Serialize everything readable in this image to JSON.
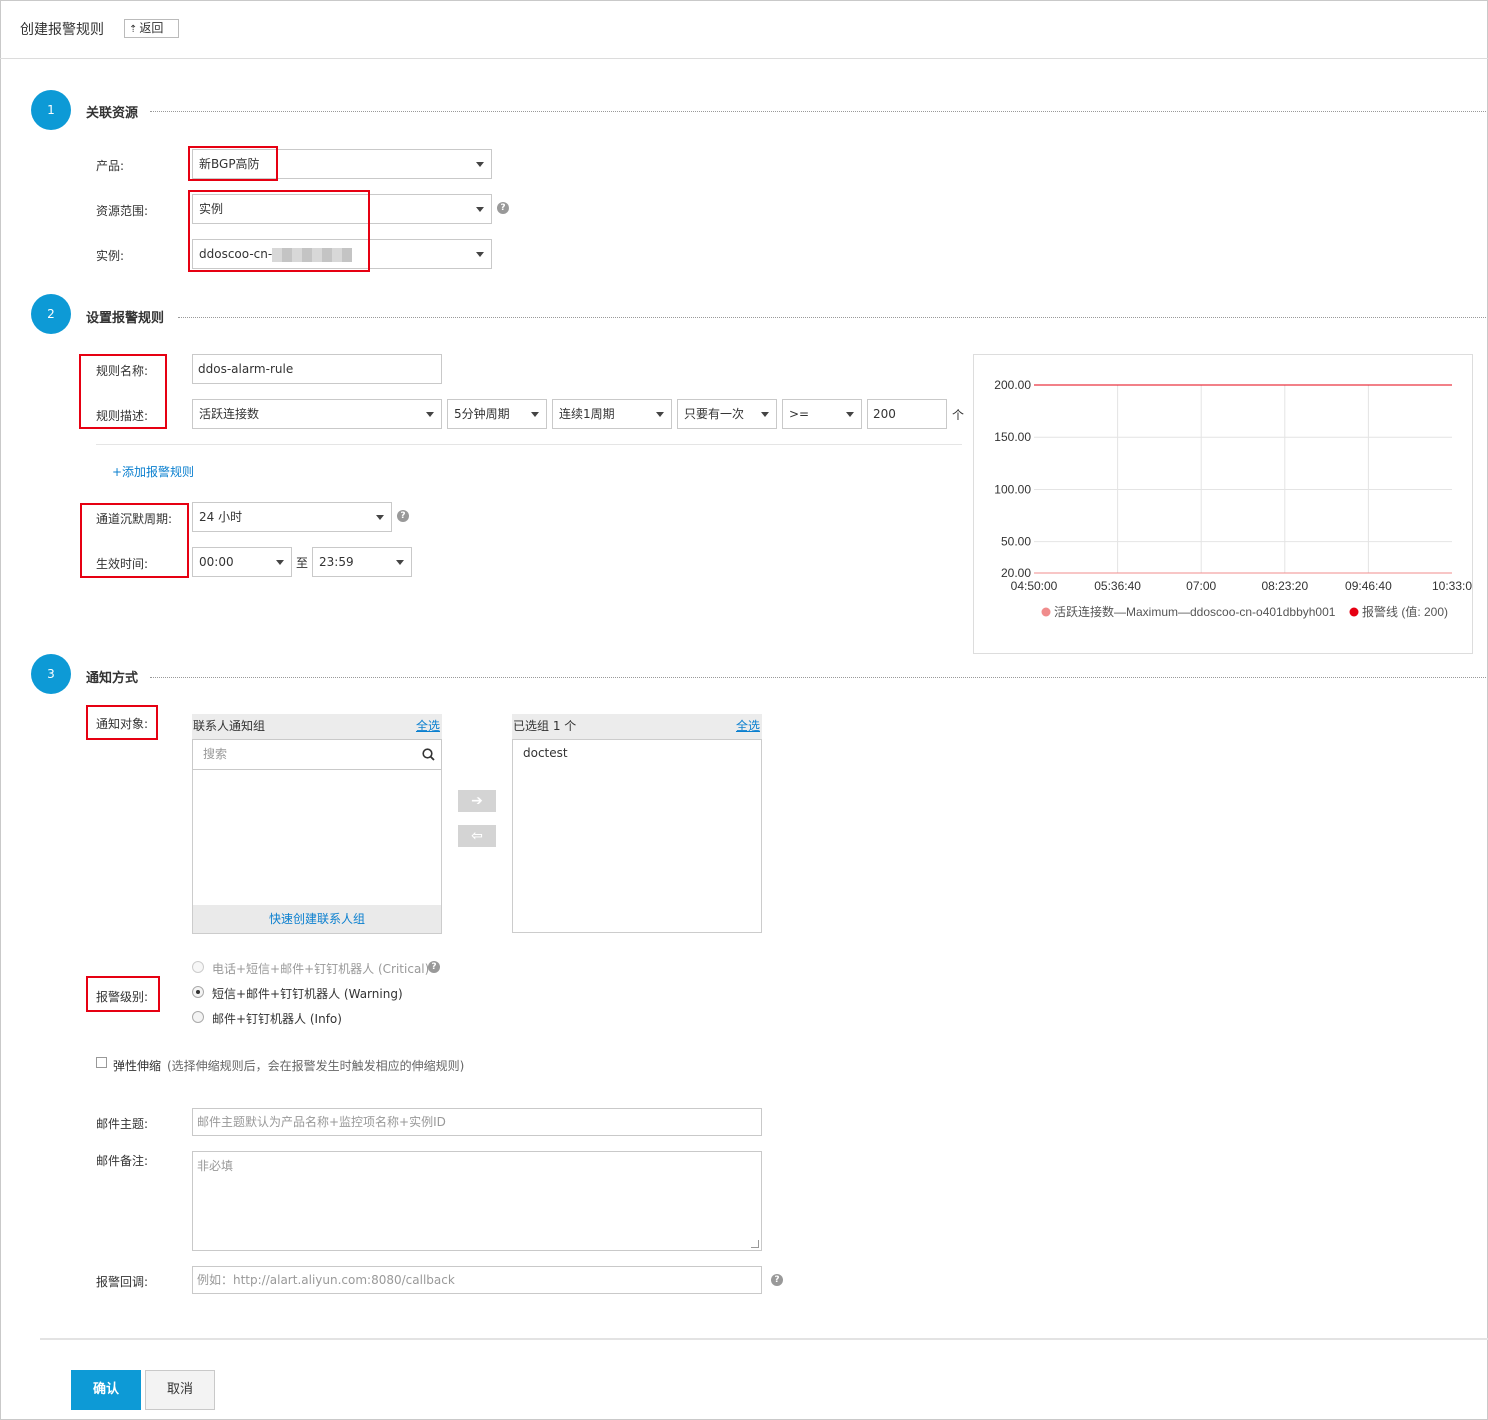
{
  "header": {
    "title": "创建报警规则",
    "back_label": "返回"
  },
  "step1": {
    "number": "1",
    "title": "关联资源",
    "product_label": "产品:",
    "product_value": "新BGP高防",
    "scope_label": "资源范围:",
    "scope_value": "实例",
    "instance_label": "实例:",
    "instance_value": "ddoscoo-cn-"
  },
  "step2": {
    "number": "2",
    "title": "设置报警规则",
    "rule_name_label": "规则名称:",
    "rule_name_value": "ddos-alarm-rule",
    "rule_desc_label": "规则描述:",
    "metric_value": "活跃连接数",
    "period_value": "5分钟周期",
    "consecutive_value": "连续1周期",
    "frequency_value": "只要有一次",
    "operator_value": ">=",
    "threshold_value": "200",
    "unit": "个",
    "add_rule_label": "+添加报警规则",
    "silence_label": "通道沉默周期:",
    "silence_value": "24 小时",
    "effective_label": "生效时间:",
    "start_time": "00:00",
    "to_label": "至",
    "end_time": "23:59"
  },
  "chart_data": {
    "type": "line",
    "y_ticks": [
      "200.00",
      "150.00",
      "100.00",
      "50.00",
      "20.00"
    ],
    "x_ticks": [
      "04:50:00",
      "05:36:40",
      "07:00",
      "08:23:20",
      "09:46:40",
      "10:33:0"
    ],
    "ylim": [
      20,
      200
    ],
    "grid": true,
    "legend_placement": "bottom",
    "series": [
      {
        "name": "活跃连接数—Maximum—ddoscoo-cn-o401dbbyh001",
        "color": "#f08c8c",
        "values": [
          20,
          20,
          20,
          20,
          20,
          20
        ]
      },
      {
        "name": "报警线 (值: 200)",
        "color": "#e60012",
        "values": [
          200,
          200,
          200,
          200,
          200,
          200
        ]
      }
    ]
  },
  "step3": {
    "number": "3",
    "title": "通知方式",
    "target_label": "通知对象:",
    "left_panel_title": "联系人通知组",
    "select_all": "全选",
    "search_placeholder": "搜索",
    "quick_create": "快速创建联系人组",
    "right_panel_title": "已选组 1 个",
    "selected_items": [
      "doctest"
    ],
    "level_label": "报警级别:",
    "level_critical": "电话+短信+邮件+钉钉机器人 (Critical)",
    "level_warning": "短信+邮件+钉钉机器人 (Warning)",
    "level_info": "邮件+钉钉机器人 (Info)",
    "autoscale_label": "弹性伸缩",
    "autoscale_hint": "(选择伸缩规则后，会在报警发生时触发相应的伸缩规则)",
    "email_subject_label": "邮件主题:",
    "email_subject_placeholder": "邮件主题默认为产品名称+监控项名称+实例ID",
    "email_note_label": "邮件备注:",
    "email_note_placeholder": "非必填",
    "callback_label": "报警回调:",
    "callback_placeholder": "例如：http://alart.aliyun.com:8080/callback"
  },
  "footer": {
    "confirm_label": "确认",
    "cancel_label": "取消"
  },
  "colors": {
    "accent": "#0d9ad6",
    "highlight": "#e60012",
    "link": "#0a7fcf"
  }
}
